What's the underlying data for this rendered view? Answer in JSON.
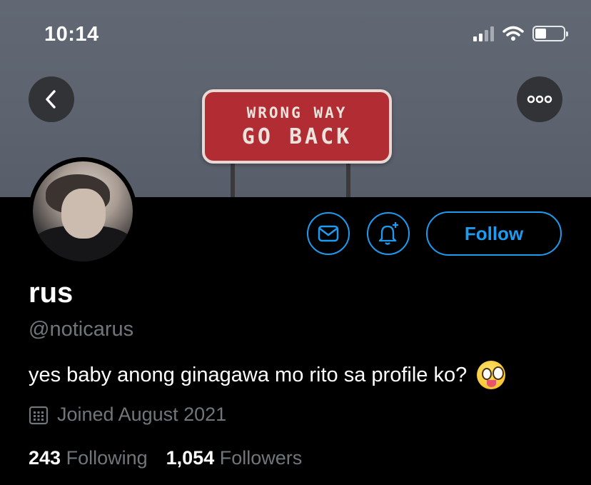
{
  "status_bar": {
    "time": "10:14",
    "battery_level": 0.4,
    "signal_bars_active": 2
  },
  "banner": {
    "sign_line1": "WRONG WAY",
    "sign_line2": "GO BACK",
    "back_icon": "chevron-left-icon",
    "more_icon": "ellipsis-icon"
  },
  "profile": {
    "name": "rus",
    "handle": "@noticarus",
    "bio": "yes baby anong ginagawa mo rito sa profile ko?",
    "bio_emoji": "zany-face-emoji",
    "joined": "Joined August 2021",
    "following_count": "243",
    "following_label": "Following",
    "followers_count": "1,054",
    "followers_label": "Followers"
  },
  "actions": {
    "message_icon": "envelope-icon",
    "notify_icon": "bell-plus-icon",
    "follow_label": "Follow"
  },
  "colors": {
    "accent": "#1d9bf0",
    "muted_text": "#71767b",
    "background": "#000000"
  }
}
